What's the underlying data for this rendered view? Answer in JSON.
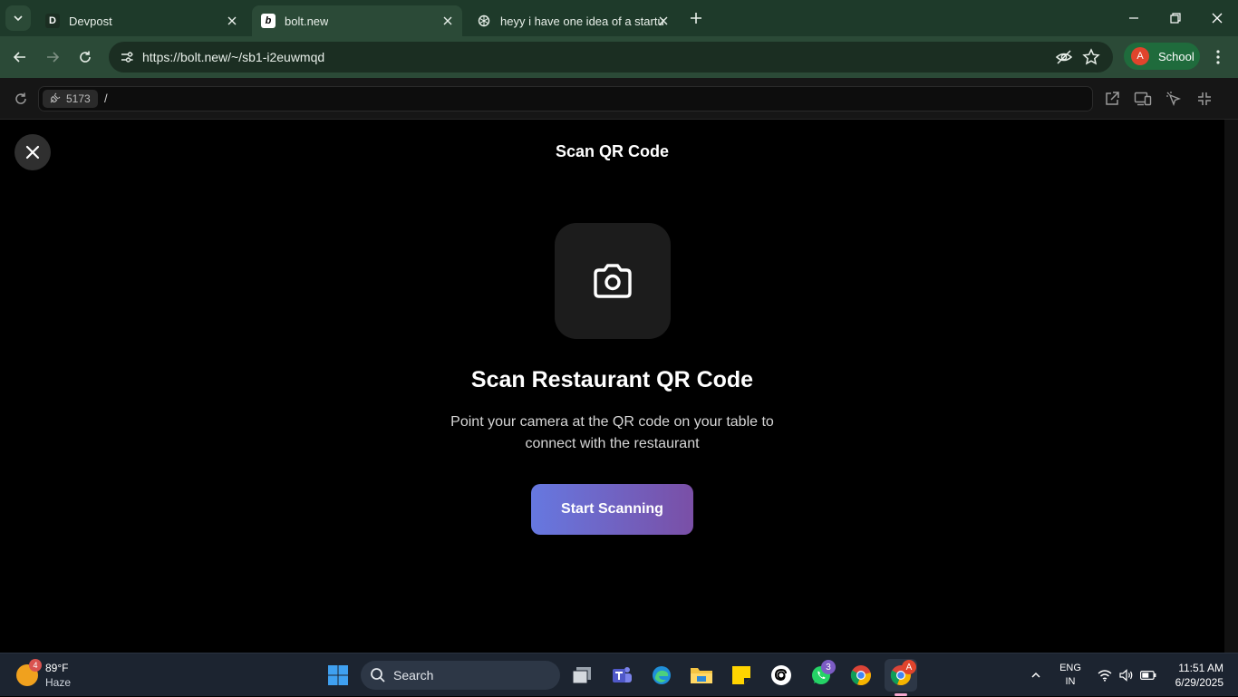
{
  "browser": {
    "tabs": [
      {
        "favicon_letter": "D",
        "title": "Devpost",
        "active": false
      },
      {
        "favicon_letter": "b",
        "title": "bolt.new",
        "active": true
      },
      {
        "favicon_letter": "",
        "title": "heyy i have one idea of a startu",
        "active": false
      }
    ],
    "url": "https://bolt.new/~/sb1-i2euwmqd",
    "profile": {
      "initial": "A",
      "name": "School"
    }
  },
  "preview": {
    "port": "5173",
    "path": "/"
  },
  "app": {
    "page_title": "Scan QR Code",
    "headline": "Scan Restaurant QR Code",
    "subtext": "Point your camera at the QR code on your table to connect with the restaurant",
    "button_label": "Start Scanning",
    "accent_gradient": [
      "#6678e0",
      "#7a4fa6"
    ]
  },
  "taskbar": {
    "weather": {
      "badge": "4",
      "temp": "89°F",
      "condition": "Haze"
    },
    "search_label": "Search",
    "whatsapp_badge": "3",
    "chrome_profile_badge": "A",
    "language": {
      "line1": "ENG",
      "line2": "IN"
    },
    "time": "11:51 AM",
    "date": "6/29/2025"
  }
}
